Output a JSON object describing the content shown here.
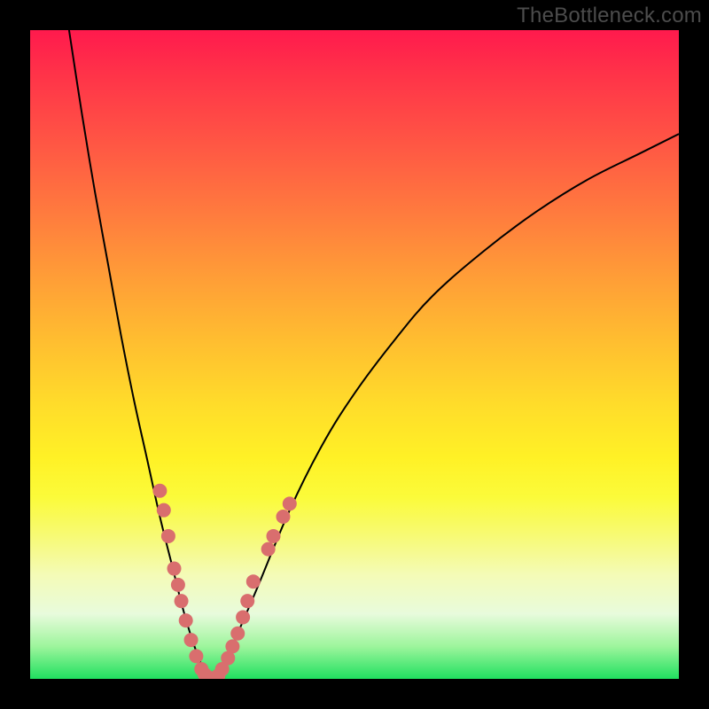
{
  "watermark": "TheBottleneck.com",
  "chart_data": {
    "type": "line",
    "title": "",
    "xlabel": "",
    "ylabel": "",
    "xlim": [
      0,
      100
    ],
    "ylim": [
      0,
      100
    ],
    "grid": false,
    "legend": false,
    "background": "rainbow-gradient-red-to-green",
    "series": [
      {
        "name": "left-branch",
        "x": [
          6,
          8,
          10,
          12,
          14,
          16,
          18,
          20,
          22,
          23.5,
          25,
          26.5,
          28
        ],
        "y": [
          100,
          87,
          75,
          64,
          53,
          43,
          34,
          25,
          17,
          11,
          6,
          2,
          0
        ]
      },
      {
        "name": "right-branch",
        "x": [
          28,
          30,
          32,
          35,
          40,
          45,
          50,
          56,
          62,
          70,
          78,
          86,
          94,
          100
        ],
        "y": [
          0,
          2,
          7,
          14,
          26,
          36,
          44,
          52,
          59,
          66,
          72,
          77,
          81,
          84
        ]
      }
    ],
    "markers": {
      "name": "data-points",
      "color": "#d96e6e",
      "radius_px": 8,
      "points": [
        {
          "x": 20.0,
          "y": 29
        },
        {
          "x": 20.6,
          "y": 26
        },
        {
          "x": 21.3,
          "y": 22
        },
        {
          "x": 22.2,
          "y": 17
        },
        {
          "x": 22.8,
          "y": 14.5
        },
        {
          "x": 23.3,
          "y": 12
        },
        {
          "x": 24.0,
          "y": 9
        },
        {
          "x": 24.8,
          "y": 6
        },
        {
          "x": 25.6,
          "y": 3.5
        },
        {
          "x": 26.4,
          "y": 1.5
        },
        {
          "x": 26.9,
          "y": 0.7
        },
        {
          "x": 27.5,
          "y": 0.2
        },
        {
          "x": 28.4,
          "y": 0.1
        },
        {
          "x": 29.0,
          "y": 0.5
        },
        {
          "x": 29.6,
          "y": 1.5
        },
        {
          "x": 30.5,
          "y": 3.2
        },
        {
          "x": 31.2,
          "y": 5
        },
        {
          "x": 32.0,
          "y": 7
        },
        {
          "x": 32.8,
          "y": 9.5
        },
        {
          "x": 33.5,
          "y": 12
        },
        {
          "x": 34.4,
          "y": 15
        },
        {
          "x": 36.7,
          "y": 20
        },
        {
          "x": 37.5,
          "y": 22
        },
        {
          "x": 39.0,
          "y": 25
        },
        {
          "x": 40.0,
          "y": 27
        }
      ]
    }
  }
}
